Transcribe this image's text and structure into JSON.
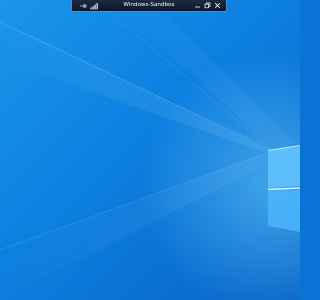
{
  "connection_bar": {
    "title": "Windows-Sandbox",
    "buttons": {
      "pin": "pin-icon",
      "connection": "signal-bars-icon",
      "minimize": "minimize-icon",
      "restore": "restore-icon",
      "close": "close-icon"
    }
  },
  "desktop": {
    "wallpaper": "windows-10-hero-light",
    "colors": {
      "base": "#0a74d6",
      "light": "#2ba8f2",
      "dark": "#0655b8",
      "bar": "#0d1628",
      "bar_border": "#5b86c4"
    }
  }
}
